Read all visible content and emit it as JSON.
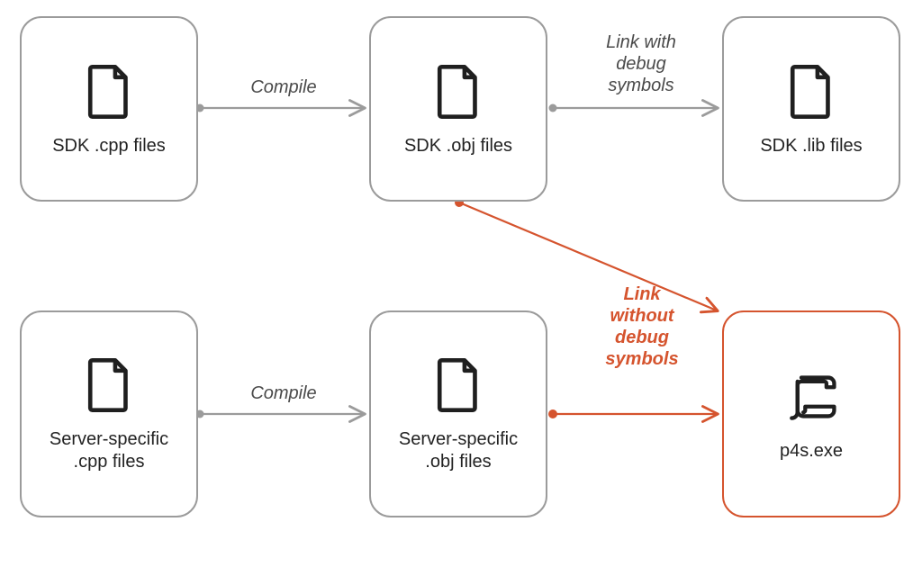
{
  "nodes": {
    "sdk_cpp": {
      "label": "SDK .cpp files"
    },
    "sdk_obj": {
      "label": "SDK .obj files"
    },
    "sdk_lib": {
      "label": "SDK .lib files"
    },
    "srv_cpp": {
      "label": "Server-specific\n.cpp files"
    },
    "srv_obj": {
      "label": "Server-specific\n.obj files"
    },
    "p4s": {
      "label": "p4s.exe"
    }
  },
  "edges": {
    "compile1": {
      "label": "Compile"
    },
    "link_dbg": {
      "label": "Link with\ndebug\nsymbols"
    },
    "compile2": {
      "label": "Compile"
    },
    "link_nodbg": {
      "label": "Link\nwithout\ndebug\nsymbols"
    }
  },
  "colors": {
    "gray": "#9b9b9b",
    "orange": "#d5542e"
  }
}
